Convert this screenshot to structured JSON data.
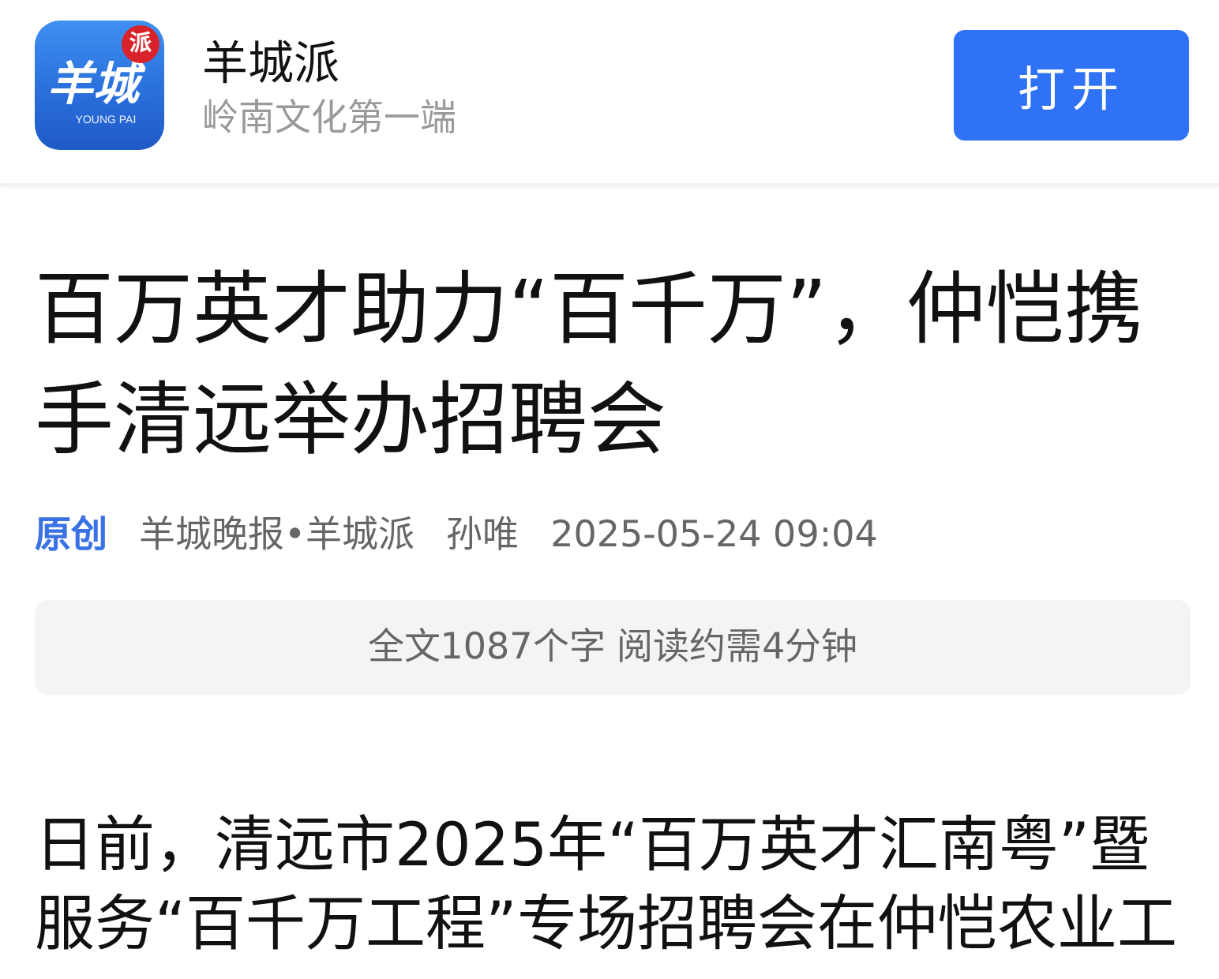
{
  "app_banner": {
    "logo": {
      "mark": "羊城",
      "badge": "派",
      "tagline": "YOUNG PAI"
    },
    "name": "羊城派",
    "slogan": "岭南文化第一端",
    "open_button": "打开"
  },
  "article": {
    "title": "百万英才助力“百千万”，仲恺携手清远举办招聘会",
    "meta": {
      "tag": "原创",
      "source": "羊城晚报•羊城派",
      "author": "孙唯",
      "time": "2025-05-24 09:04"
    },
    "reading_info": "全文1087个字 阅读约需4分钟",
    "paragraphs": [
      "日前，清远市2025年“百万英才汇南粤”暨服务“百千万工程”专场招聘会在仲恺农业工"
    ]
  }
}
